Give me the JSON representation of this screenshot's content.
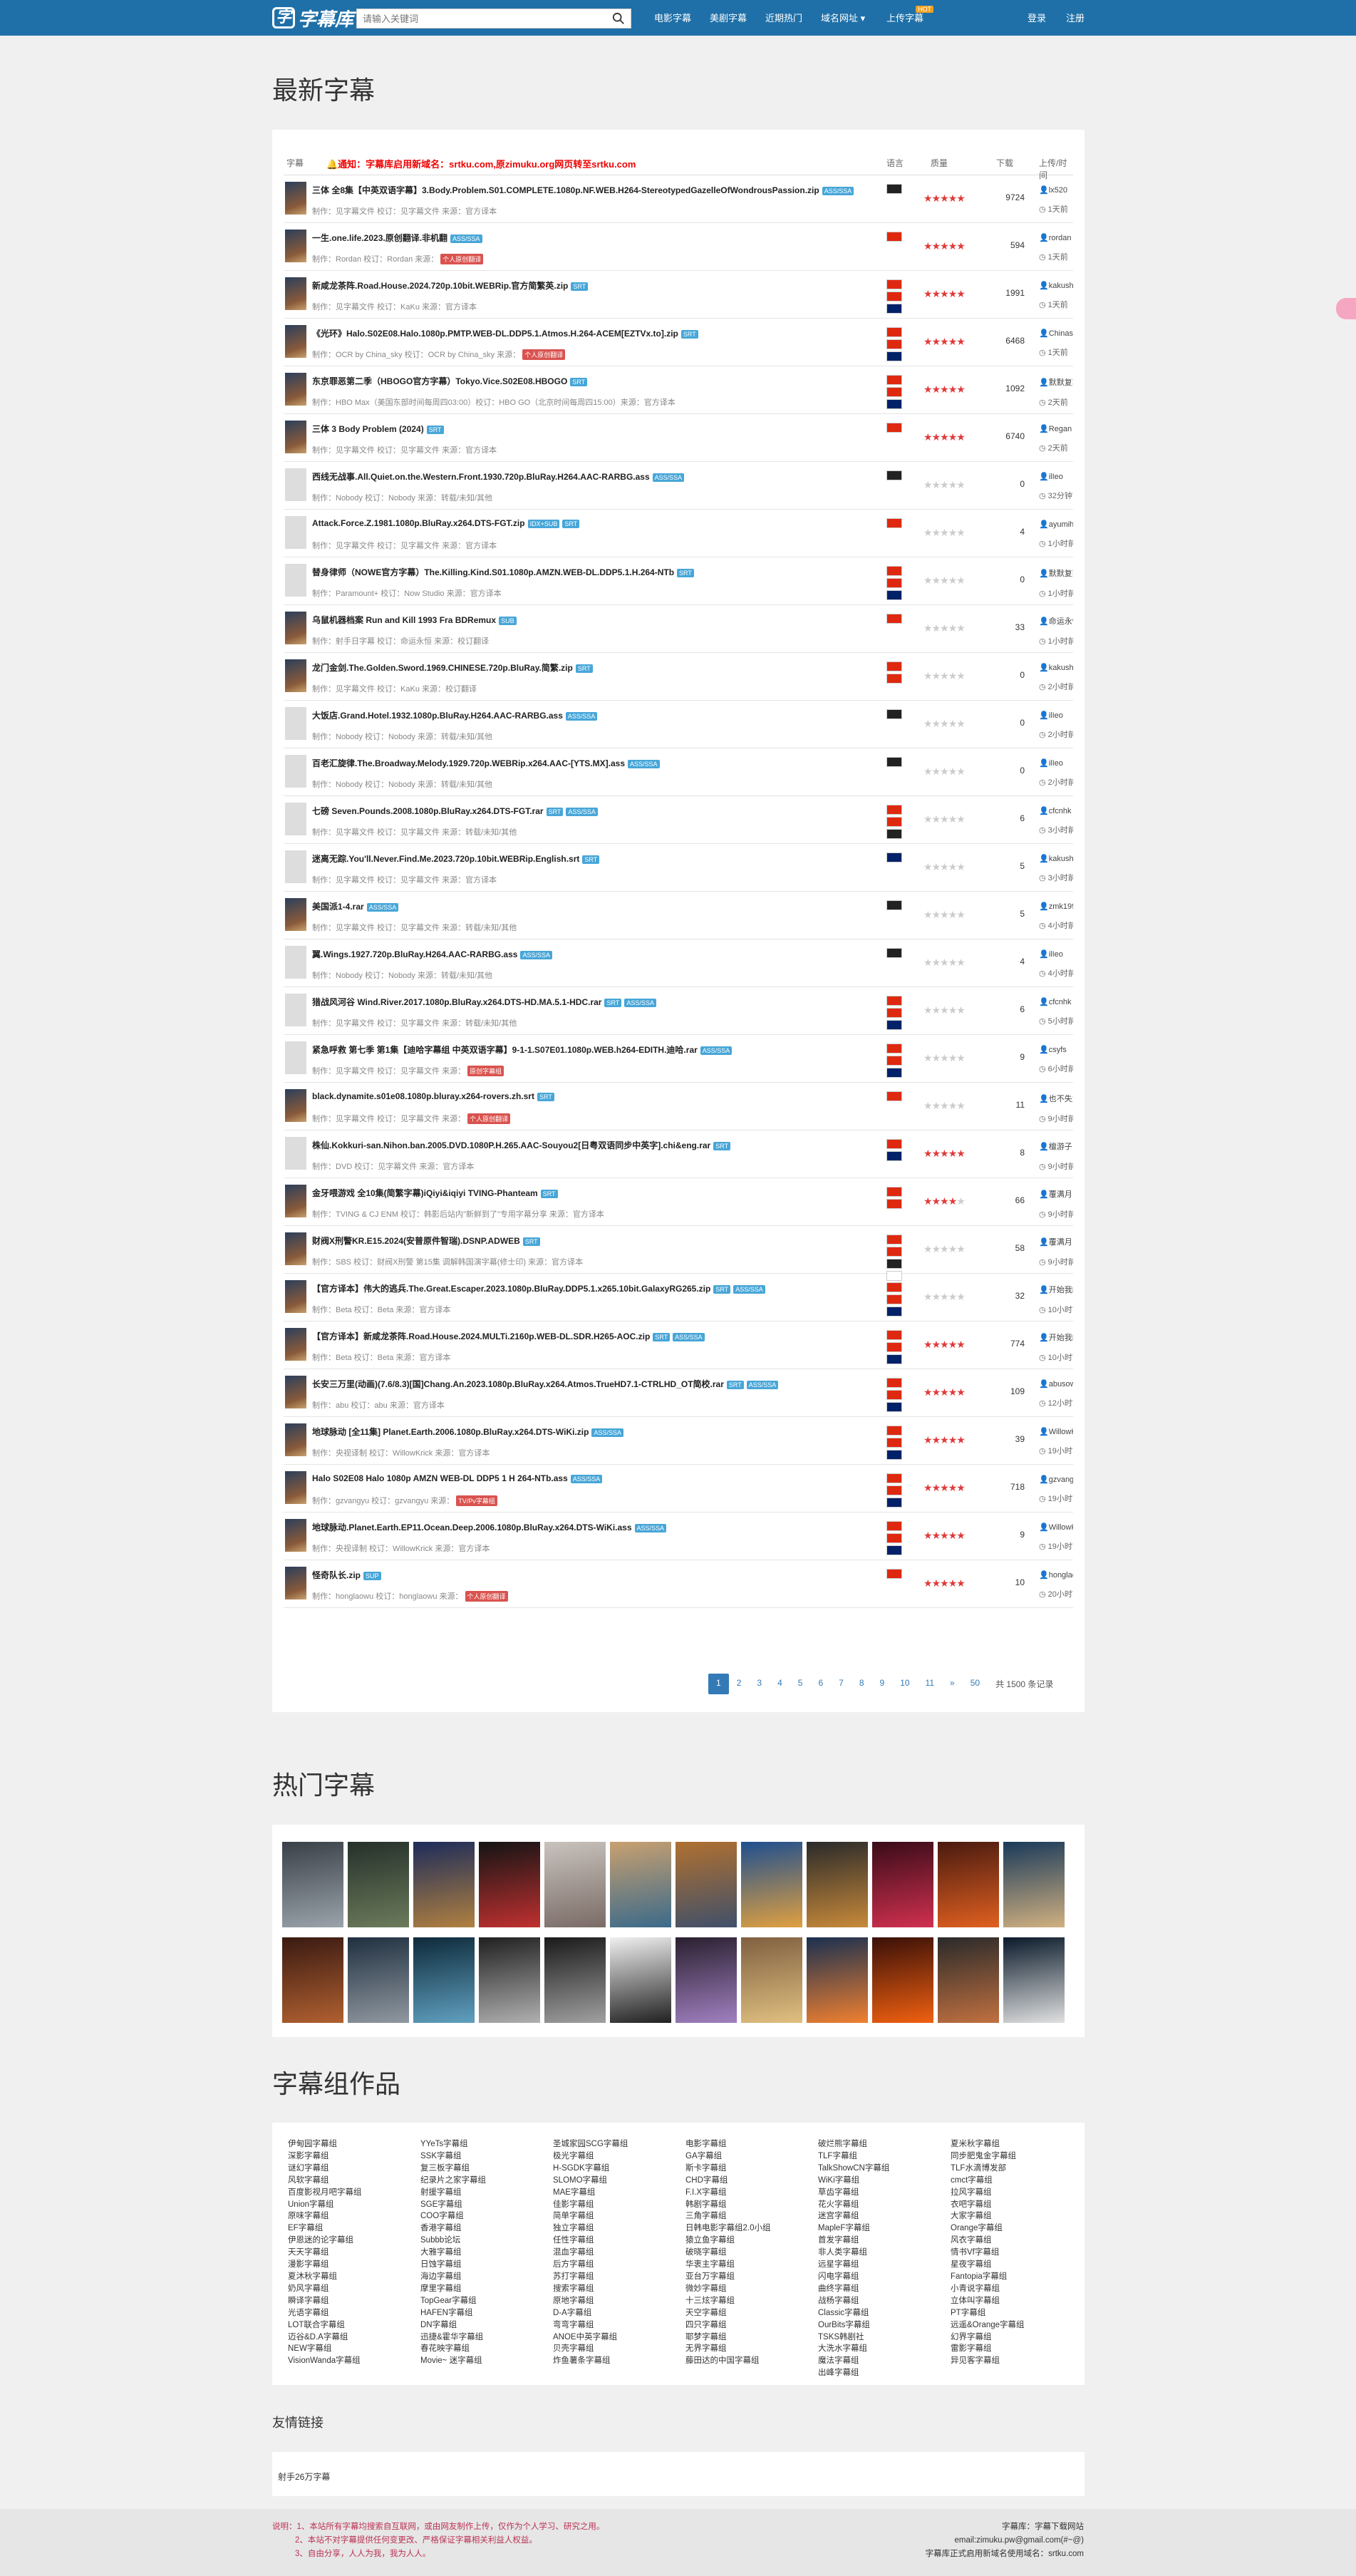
{
  "nav": {
    "logo": "字幕库",
    "search_placeholder": "请输入关键词",
    "links": [
      "电影字幕",
      "美剧字幕",
      "近期热门",
      "域名网址 ▾",
      "上传字幕"
    ],
    "hot_badge": "HOT",
    "login": "登录",
    "register": "注册"
  },
  "latest": {
    "heading": "最新字幕",
    "col_subtitle": "字幕",
    "col_lang": "语言",
    "col_rating": "质量",
    "col_downloads": "下载",
    "col_uploader": "上传/时间",
    "notice": "🔔通知：字幕库启用新域名：srtku.com,原zimuku.org网页转至srtku.com",
    "rows": [
      {
        "title": "三体 全8集【中英双语字幕】3.Body.Problem.S01.COMPLETE.1080p.NF.WEB.H264-StereotypedGazelleOfWondrousPassion.zip",
        "tags": [
          "ASS/SSA"
        ],
        "meta": "制作：见字幕文件 校订：见字幕文件 来源：官方译本",
        "badge": "",
        "flags": [
          "xx"
        ],
        "stars": 5,
        "dl": "9724",
        "user": "lx520",
        "time": "1天前",
        "poster": true
      },
      {
        "title": "一生.one.life.2023.原创翻译.非机翻",
        "tags": [
          "ASS/SSA"
        ],
        "meta": "制作：Rordan 校订：Rordan 来源：",
        "badge": "个人原创翻译",
        "flags": [
          "cn"
        ],
        "stars": 5,
        "dl": "594",
        "user": "rordan",
        "time": "1天前",
        "poster": true
      },
      {
        "title": "新咸龙茶阵.Road.House.2024.720p.10bit.WEBRip.官方简繁英.zip",
        "tags": [
          "SRT"
        ],
        "meta": "制作：见字幕文件 校订：KaKu 来源：官方译本",
        "badge": "",
        "flags": [
          "hk",
          "cn",
          "uk"
        ],
        "stars": 5,
        "dl": "1991",
        "user": "kakushou",
        "time": "1天前",
        "poster": true
      },
      {
        "title": "《光环》Halo.S02E08.Halo.1080p.PMTP.WEB-DL.DDP5.1.Atmos.H.264-ACEM[EZTVx.to].zip",
        "tags": [
          "SRT"
        ],
        "meta": "制作：OCR by China_sky 校订：OCR by China_sky 来源：",
        "badge": "个人原创翻译",
        "flags": [
          "hk",
          "cn",
          "uk"
        ],
        "stars": 5,
        "dl": "6468",
        "user": "Chinasky",
        "time": "1天前",
        "poster": true
      },
      {
        "title": "东京罪恶第二季（HBOGO官方字幕）Tokyo.Vice.S02E08.HBOGO",
        "tags": [
          "SRT"
        ],
        "meta": "制作：HBO Max（美国东部时间每周四03:00）校订：HBO GO（北京时间每周四15:00）来源：官方译本",
        "badge": "",
        "flags": [
          "hk",
          "cn",
          "uk"
        ],
        "stars": 5,
        "dl": "1092",
        "user": "默默复刻了",
        "time": "2天前",
        "poster": true
      },
      {
        "title": "三体 3 Body Problem (2024)",
        "tags": [
          "SRT"
        ],
        "meta": "制作：见字幕文件 校订：见字幕文件 来源：官方译本",
        "badge": "",
        "flags": [
          "cn"
        ],
        "stars": 5,
        "dl": "6740",
        "user": "Regan",
        "time": "2天前",
        "poster": true
      },
      {
        "title": "西线无战事.All.Quiet.on.the.Western.Front.1930.720p.BluRay.H264.AAC-RARBG.ass",
        "tags": [
          "ASS/SSA"
        ],
        "meta": "制作：Nobody 校订：Nobody 来源：转载/未知/其他",
        "badge": "",
        "flags": [
          "xx"
        ],
        "stars": 0,
        "dl": "0",
        "user": "ilIeo",
        "time": "32分钟前",
        "poster": false
      },
      {
        "title": "Attack.Force.Z.1981.1080p.BluRay.x264.DTS-FGT.zip",
        "tags": [
          "IDX+SUB",
          "SRT"
        ],
        "meta": "制作：见字幕文件 校订：见字幕文件 来源：官方译本",
        "badge": "",
        "flags": [
          "cn"
        ],
        "stars": 0,
        "dl": "4",
        "user": "ayumih",
        "time": "1小时前",
        "poster": false
      },
      {
        "title": "替身律师（NOWE官方字幕）The.Killing.Kind.S01.1080p.AMZN.WEB-DL.DDP5.1.H.264-NTb",
        "tags": [
          "SRT"
        ],
        "meta": "制作：Paramount+ 校订：Now Studio 来源：官方译本",
        "badge": "",
        "flags": [
          "hk",
          "cn",
          "uk"
        ],
        "stars": 0,
        "dl": "0",
        "user": "默默复刻了",
        "time": "1小时前",
        "poster": false
      },
      {
        "title": "乌鼠机器档案 Run and Kill 1993 Fra BDRemux",
        "tags": [
          "SUB"
        ],
        "meta": "制作：射手日字幕 校订：命运永恒 来源：校订翻译",
        "badge": "",
        "flags": [
          "cn"
        ],
        "stars": 0,
        "dl": "33",
        "user": "命运永恒",
        "time": "1小时前",
        "poster": true
      },
      {
        "title": "龙门金剑.The.Golden.Sword.1969.CHINESE.720p.BluRay.简繁.zip",
        "tags": [
          "SRT"
        ],
        "meta": "制作：见字幕文件 校订：KaKu 来源：校订翻译",
        "badge": "",
        "flags": [
          "hk",
          "cn"
        ],
        "stars": 0,
        "dl": "0",
        "user": "kakushou",
        "time": "2小时前",
        "poster": true
      },
      {
        "title": "大饭店.Grand.Hotel.1932.1080p.BluRay.H264.AAC-RARBG.ass",
        "tags": [
          "ASS/SSA"
        ],
        "meta": "制作：Nobody 校订：Nobody 来源：转载/未知/其他",
        "badge": "",
        "flags": [
          "xx"
        ],
        "stars": 0,
        "dl": "0",
        "user": "ilIeo",
        "time": "2小时前",
        "poster": false
      },
      {
        "title": "百老汇旋律.The.Broadway.Melody.1929.720p.WEBRip.x264.AAC-[YTS.MX].ass",
        "tags": [
          "ASS/SSA"
        ],
        "meta": "制作：Nobody 校订：Nobody 来源：转载/未知/其他",
        "badge": "",
        "flags": [
          "xx"
        ],
        "stars": 0,
        "dl": "0",
        "user": "ilIeo",
        "time": "2小时前",
        "poster": false
      },
      {
        "title": "七磅 Seven.Pounds.2008.1080p.BluRay.x264.DTS-FGT.rar",
        "tags": [
          "SRT",
          "ASS/SSA"
        ],
        "meta": "制作：见字幕文件 校订：见字幕文件 来源：转载/未知/其他",
        "badge": "",
        "flags": [
          "hk",
          "cn",
          "xx"
        ],
        "stars": 0,
        "dl": "6",
        "user": "cfcnhk",
        "time": "3小时前",
        "poster": false
      },
      {
        "title": "迷离无踪.You'll.Never.Find.Me.2023.720p.10bit.WEBRip.English.srt",
        "tags": [
          "SRT"
        ],
        "meta": "制作：见字幕文件 校订：见字幕文件 来源：官方译本",
        "badge": "",
        "flags": [
          "uk"
        ],
        "stars": 0,
        "dl": "5",
        "user": "kakushou",
        "time": "3小时前",
        "poster": false
      },
      {
        "title": "美国派1-4.rar",
        "tags": [
          "ASS/SSA"
        ],
        "meta": "制作：见字幕文件 校订：见字幕文件 来源：转载/未知/其他",
        "badge": "",
        "flags": [
          "xx"
        ],
        "stars": 0,
        "dl": "5",
        "user": "zmk1999",
        "time": "4小时前",
        "poster": true
      },
      {
        "title": "翼.Wings.1927.720p.BluRay.H264.AAC-RARBG.ass",
        "tags": [
          "ASS/SSA"
        ],
        "meta": "制作：Nobody 校订：Nobody 来源：转载/未知/其他",
        "badge": "",
        "flags": [
          "xx"
        ],
        "stars": 0,
        "dl": "4",
        "user": "ilIeo",
        "time": "4小时前",
        "poster": false
      },
      {
        "title": "猎战风河谷 Wind.River.2017.1080p.BluRay.x264.DTS-HD.MA.5.1-HDC.rar",
        "tags": [
          "SRT",
          "ASS/SSA"
        ],
        "meta": "制作：见字幕文件 校订：见字幕文件 来源：转载/未知/其他",
        "badge": "",
        "flags": [
          "hk",
          "cn",
          "uk"
        ],
        "stars": 0,
        "dl": "6",
        "user": "cfcnhk",
        "time": "5小时前",
        "poster": false
      },
      {
        "title": "紧急呼救 第七季 第1集【迪哈字幕组 中英双语字幕】9-1-1.S07E01.1080p.WEB.h264-EDITH.迪哈.rar",
        "tags": [
          "ASS/SSA"
        ],
        "meta": "制作：见字幕文件 校订：见字幕文件 来源：",
        "badge": "原创字幕组",
        "flags": [
          "hk",
          "cn",
          "uk"
        ],
        "stars": 0,
        "dl": "9",
        "user": "csyfs",
        "time": "6小时前",
        "poster": false
      },
      {
        "title": "black.dynamite.s01e08.1080p.bluray.x264-rovers.zh.srt",
        "tags": [
          "SRT"
        ],
        "meta": "制作：见字幕文件 校订：见字幕文件 来源：",
        "badge": "个人原创翻译",
        "flags": [
          "cn"
        ],
        "stars": 0,
        "dl": "11",
        "user": "也不失为一",
        "time": "9小时前",
        "poster": true
      },
      {
        "title": "株仙.Kokkuri-san.Nihon.ban.2005.DVD.1080P.H.265.AAC-Souyou2[日粤双语同步中英字].chi&eng.rar",
        "tags": [
          "SRT"
        ],
        "meta": "制作：DVD 校订：见字幕文件 来源：官方译本",
        "badge": "",
        "flags": [
          "hk",
          "uk"
        ],
        "stars": 5,
        "dl": "8",
        "user": "檀游子",
        "time": "9小时前",
        "poster": false
      },
      {
        "title": "金牙喂游戏 全10集(简繁字幕)iQiyi&iqiyi TVING-Phanteam",
        "tags": [
          "SRT"
        ],
        "meta": "制作：TVING & CJ ENM 校订：韩影后站内\"新鲜到了\"专用字幕分享 来源：官方译本",
        "badge": "",
        "flags": [
          "hk",
          "cn"
        ],
        "stars": 4,
        "dl": "66",
        "user": "覆满月",
        "time": "9小时前",
        "poster": true
      },
      {
        "title": "财阀X刑警KR.E15.2024(安普原件智瑞).DSNP.ADWEB",
        "tags": [
          "SRT"
        ],
        "meta": "制作：SBS 校订：财阀X刑警 第15集 调解韩国演字幕(修士印) 来源：官方译本",
        "badge": "",
        "flags": [
          "hk",
          "cn",
          "xx",
          "jp"
        ],
        "stars": 0,
        "dl": "58",
        "user": "覆满月",
        "time": "9小时前",
        "poster": true
      },
      {
        "title": "【官方译本】伟大的逃兵.The.Great.Escaper.2023.1080p.BluRay.DDP5.1.x265.10bit.GalaxyRG265.zip",
        "tags": [
          "SRT",
          "ASS/SSA"
        ],
        "meta": "制作：Beta 校订：Beta 来源：官方译本",
        "badge": "",
        "flags": [
          "hk",
          "cn",
          "uk"
        ],
        "stars": 0,
        "dl": "32",
        "user": "开始我的",
        "time": "10小时前",
        "poster": true
      },
      {
        "title": "【官方译本】新咸龙茶阵.Road.House.2024.MULTi.2160p.WEB-DL.SDR.H265-AOC.zip",
        "tags": [
          "SRT",
          "ASS/SSA"
        ],
        "meta": "制作：Beta 校订：Beta 来源：官方译本",
        "badge": "",
        "flags": [
          "hk",
          "cn",
          "uk"
        ],
        "stars": 5,
        "dl": "774",
        "user": "开始我的",
        "time": "10小时前",
        "poster": true
      },
      {
        "title": "长安三万里(动画)(7.6/8.3)[国]Chang.An.2023.1080p.BluRay.x264.Atmos.TrueHD7.1-CTRLHD_OT简校.rar",
        "tags": [
          "SRT",
          "ASS/SSA"
        ],
        "meta": "制作：abu 校订：abu 来源：官方译本",
        "badge": "",
        "flags": [
          "hk",
          "cn",
          "uk"
        ],
        "stars": 5,
        "dl": "109",
        "user": "abusow",
        "time": "12小时前",
        "poster": true
      },
      {
        "title": "地球脉动 [全11集] Planet.Earth.2006.1080p.BluRay.x264.DTS-WiKi.zip",
        "tags": [
          "ASS/SSA"
        ],
        "meta": "制作：央视译制 校订：WillowKrick 来源：官方译本",
        "badge": "",
        "flags": [
          "hk",
          "cn",
          "uk"
        ],
        "stars": 5,
        "dl": "39",
        "user": "WillowKrick",
        "time": "19小时前",
        "poster": true
      },
      {
        "title": "Halo S02E08 Halo 1080p AMZN WEB-DL DDP5 1 H 264-NTb.ass",
        "tags": [
          "ASS/SSA"
        ],
        "meta": "制作：gzvangyu 校订：gzvangyu 来源：",
        "badge": "TV/Pv字幕组",
        "flags": [
          "hk",
          "cn",
          "uk"
        ],
        "stars": 5,
        "dl": "718",
        "user": "gzvangyu",
        "time": "19小时前",
        "poster": true
      },
      {
        "title": "地球脉动.Planet.Earth.EP11.Ocean.Deep.2006.1080p.BluRay.x264.DTS-WiKi.ass",
        "tags": [
          "ASS/SSA"
        ],
        "meta": "制作：央视译制 校订：WillowKrick 来源：官方译本",
        "badge": "",
        "flags": [
          "hk",
          "cn",
          "uk"
        ],
        "stars": 5,
        "dl": "9",
        "user": "WillowKrick",
        "time": "19小时前",
        "poster": true
      },
      {
        "title": "怪奇队长.zip",
        "tags": [
          "SUP"
        ],
        "meta": "制作：honglaowu 校订：honglaowu 来源：",
        "badge": "个人原创翻译",
        "flags": [
          "cn"
        ],
        "stars": 5,
        "dl": "10",
        "user": "honglaowu",
        "time": "20小时前",
        "poster": true
      }
    ],
    "pager": {
      "pages": [
        "1",
        "2",
        "3",
        "4",
        "5",
        "6",
        "7",
        "8",
        "9",
        "10",
        "11",
        "»",
        "50"
      ],
      "total": "共 1500 条记录"
    }
  },
  "hot": {
    "heading": "热门字幕"
  },
  "groups": {
    "heading": "字幕组作品",
    "columns": [
      [
        "伊甸园字幕组",
        "深影字幕组",
        "谜幻字幕组",
        "风软字幕组",
        "百度影视月吧字幕组",
        "Union字幕组",
        "原味字幕组",
        "EF字幕组",
        "伊恩迷的论字幕组",
        "天天字幕组",
        "漫影字幕组",
        "夏沐秋字幕组",
        "奶风字幕组",
        "瞬译字幕组",
        "光语字幕组",
        "LOT联合字幕组",
        "迈谷&D.A字幕组",
        "NEW字幕组",
        "VisionWanda字幕组"
      ],
      [
        "YYeTs字幕组",
        "SSK字幕组",
        "复三板字幕组",
        "纪录片之家字幕组",
        "射援字幕组",
        "SGE字幕组",
        "COO字幕组",
        "香港字幕组",
        "Subbb论坛",
        "大雅字幕组",
        "日蚀字幕组",
        "海边字幕组",
        "摩里字幕组",
        "TopGear字幕组",
        "HAFEN字幕组",
        "DN字幕组",
        "迅捷&霍华字幕组",
        "春花映字幕组",
        "Movie~ 迷字幕组"
      ],
      [
        "圣城家园SCG字幕组",
        "极光字幕组",
        "H-SGDK字幕组",
        "SLOMO字幕组",
        "MAE字幕组",
        "佳影字幕组",
        "简单字幕组",
        "独立字幕组",
        "任性字幕组",
        "混血字幕组",
        "后方字幕组",
        "苏打字幕组",
        "搜索字幕组",
        "原地字幕组",
        "D-A字幕组",
        "弯弯字幕组",
        "ANOE中英字幕组",
        "贝壳字幕组",
        "炸鱼薯条字幕组"
      ],
      [
        "电影字幕组",
        "GA字幕组",
        "斯卡字幕组",
        "CHD字幕组",
        "F.I.X字幕组",
        "韩剧字幕组",
        "三角字幕组",
        "日韩电影字幕组2.0小组",
        "猿立鱼字幕组",
        "破晓字幕组",
        "华衷主字幕组",
        "亚台万字幕组",
        "微妙字幕组",
        "十三炫字幕组",
        "天空字幕组",
        "四只字幕组",
        "耶梦字幕组",
        "无界字幕组",
        "藤田达的中国字幕组"
      ],
      [
        "破烂熊字幕组",
        "TLF字幕组",
        "TalkShowCN字幕组",
        "WiKi字幕组",
        "草齿字幕组",
        "花火字幕组",
        "迷宫字幕组",
        "MapleF字幕组",
        "首发字幕组",
        "非人类字幕组",
        "远星字幕组",
        "闪电字幕组",
        "曲终字幕组",
        "战杨字幕组",
        "Classic字幕组",
        "OurBits字幕组",
        "TSKS韩剧社",
        "大洗水字幕组",
        "魔法字幕组",
        "出峰字幕组"
      ],
      [
        "夏米秋字幕组",
        "同步肥鬼金字幕组",
        "TLF水滴博发部",
        "cmct字幕组",
        "拉风字幕组",
        "衣吧字幕组",
        "大家字幕组",
        "Orange字幕组",
        "风衣字幕组",
        "情书Vf字幕组",
        "星夜字幕组",
        "Fantopia字幕组",
        "小青说字幕组",
        "立体叫字幕组",
        "PT字幕组",
        "远遥&Orange字幕组",
        "幻界字幕组",
        "雷影字幕组",
        "异见客字幕组"
      ]
    ]
  },
  "friends": {
    "heading": "友情链接",
    "text": "射手26万字幕"
  },
  "footer": {
    "left": [
      "说明：1、本站所有字幕均搜索自互联网，或由网友制作上传，仅作为个人学习、研究之用。",
      "2、本站不对字幕提供任何变更改、严格保证字幕相关利益人权益。",
      "3、自由分享，人人为我，我为人人。"
    ],
    "right": [
      "字幕库：字幕下载网站",
      "email:zimuku.pw@gmail.com(#~@)",
      "字幕库正式启用新域名使用域名：srtku.com"
    ]
  },
  "colors": {
    "nav": "#1f70a8",
    "star_on": "#e03a3a",
    "tag": "#47a6d8",
    "badge": "#d9534f"
  }
}
